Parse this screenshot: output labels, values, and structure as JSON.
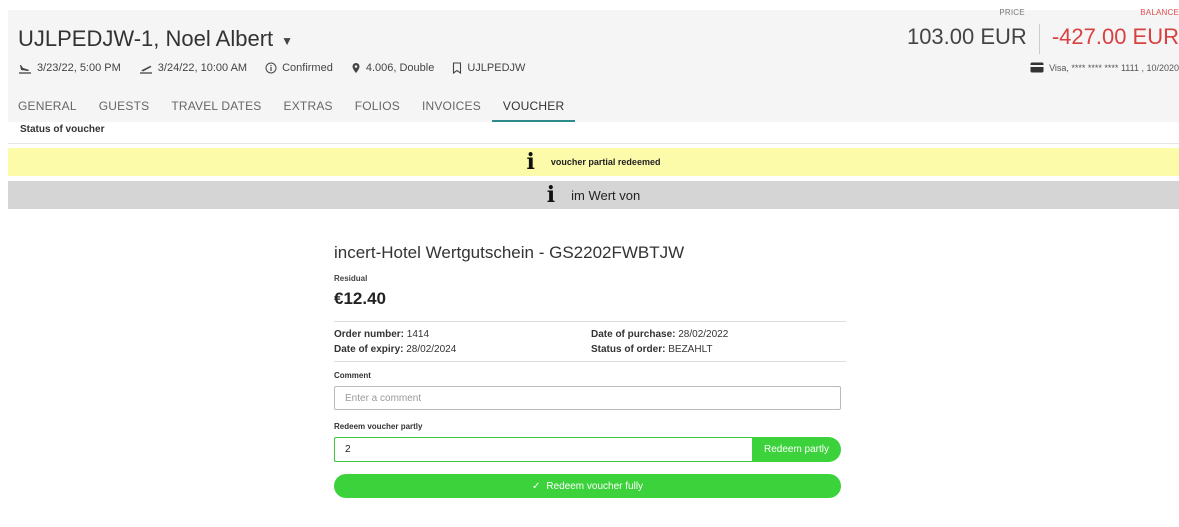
{
  "reservation": {
    "title": "UJLPEDJW-1, Noel Albert",
    "arrival": "3/23/22, 5:00 PM",
    "departure": "3/24/22, 10:00 AM",
    "status": "Confirmed",
    "unit": "4.006, Double",
    "booking_ref": "UJLPEDJW",
    "price_label": "PRICE",
    "price": "103.00 EUR",
    "balance_label": "BALANCE",
    "balance": "-427.00 EUR",
    "payment_card": "Visa, **** **** **** 1111 , 10/2020"
  },
  "tabs": [
    {
      "label": "GENERAL"
    },
    {
      "label": "GUESTS"
    },
    {
      "label": "TRAVEL DATES"
    },
    {
      "label": "EXTRAS"
    },
    {
      "label": "FOLIOS"
    },
    {
      "label": "INVOICES"
    },
    {
      "label": "VOUCHER",
      "active": true
    }
  ],
  "section_label": "Status of voucher",
  "banners": {
    "status": "voucher partial redeemed",
    "value": "im Wert von"
  },
  "voucher": {
    "title": "incert-Hotel Wertgutschein - GS2202FWBTJW",
    "residual_label": "Residual",
    "residual": "€12.40",
    "order_number_label": "Order number:",
    "order_number": "1414",
    "purchase_date_label": "Date of purchase:",
    "purchase_date": "28/02/2022",
    "expiry_label": "Date of expiry:",
    "expiry": "28/02/2024",
    "order_status_label": "Status of order:",
    "order_status": "BEZAHLT",
    "comment_label": "Comment",
    "comment_placeholder": "Enter a comment",
    "redeem_partly_label": "Redeem voucher partly",
    "redeem_partly_value": "2",
    "redeem_partly_button": "Redeem partly",
    "redeem_fully_button": "Redeem voucher fully"
  },
  "colors": {
    "accent_tab": "#2e8b8b",
    "balance_red": "#d94040",
    "button_green": "#3cd23c",
    "banner_yellow": "#fbfbaa",
    "banner_grey": "#d5d5d5"
  }
}
